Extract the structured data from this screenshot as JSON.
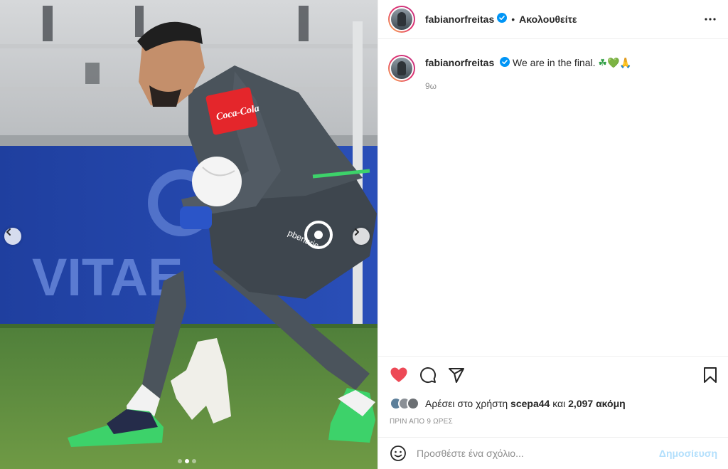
{
  "header": {
    "username": "fabianorfreitas",
    "separator": "•",
    "follow_label": "Ακολουθείτε",
    "more_icon": "more-horizontal-icon"
  },
  "caption": {
    "username": "fabianorfreitas",
    "text": "We are in the final.",
    "emojis": "☘💚🙏",
    "time": "9ω"
  },
  "media": {
    "sponsor_text": "Coca-Cola",
    "banner_text": "VITAE",
    "shorts_text": "pbenarie",
    "carousel": {
      "count": 3,
      "active_index": 1
    }
  },
  "actions": {
    "like_icon": "heart-filled-icon",
    "comment_icon": "comment-icon",
    "share_icon": "share-icon",
    "save_icon": "bookmark-icon",
    "like_color": "#ed4956"
  },
  "likes": {
    "prefix": "Αρέσει στο χρήστη",
    "user": "scepa44",
    "conjunction": "και",
    "count": "2,097 ακόμη"
  },
  "timestamp": "ΠΡΙΝ ΑΠΟ 9 ΩΡΕΣ",
  "comment": {
    "placeholder": "Προσθέστε ένα σχόλιο...",
    "publish_label": "Δημοσίευση"
  },
  "colors": {
    "accent": "#0095f6",
    "verified": "#0095f6",
    "publish_disabled": "#b2dffc"
  }
}
